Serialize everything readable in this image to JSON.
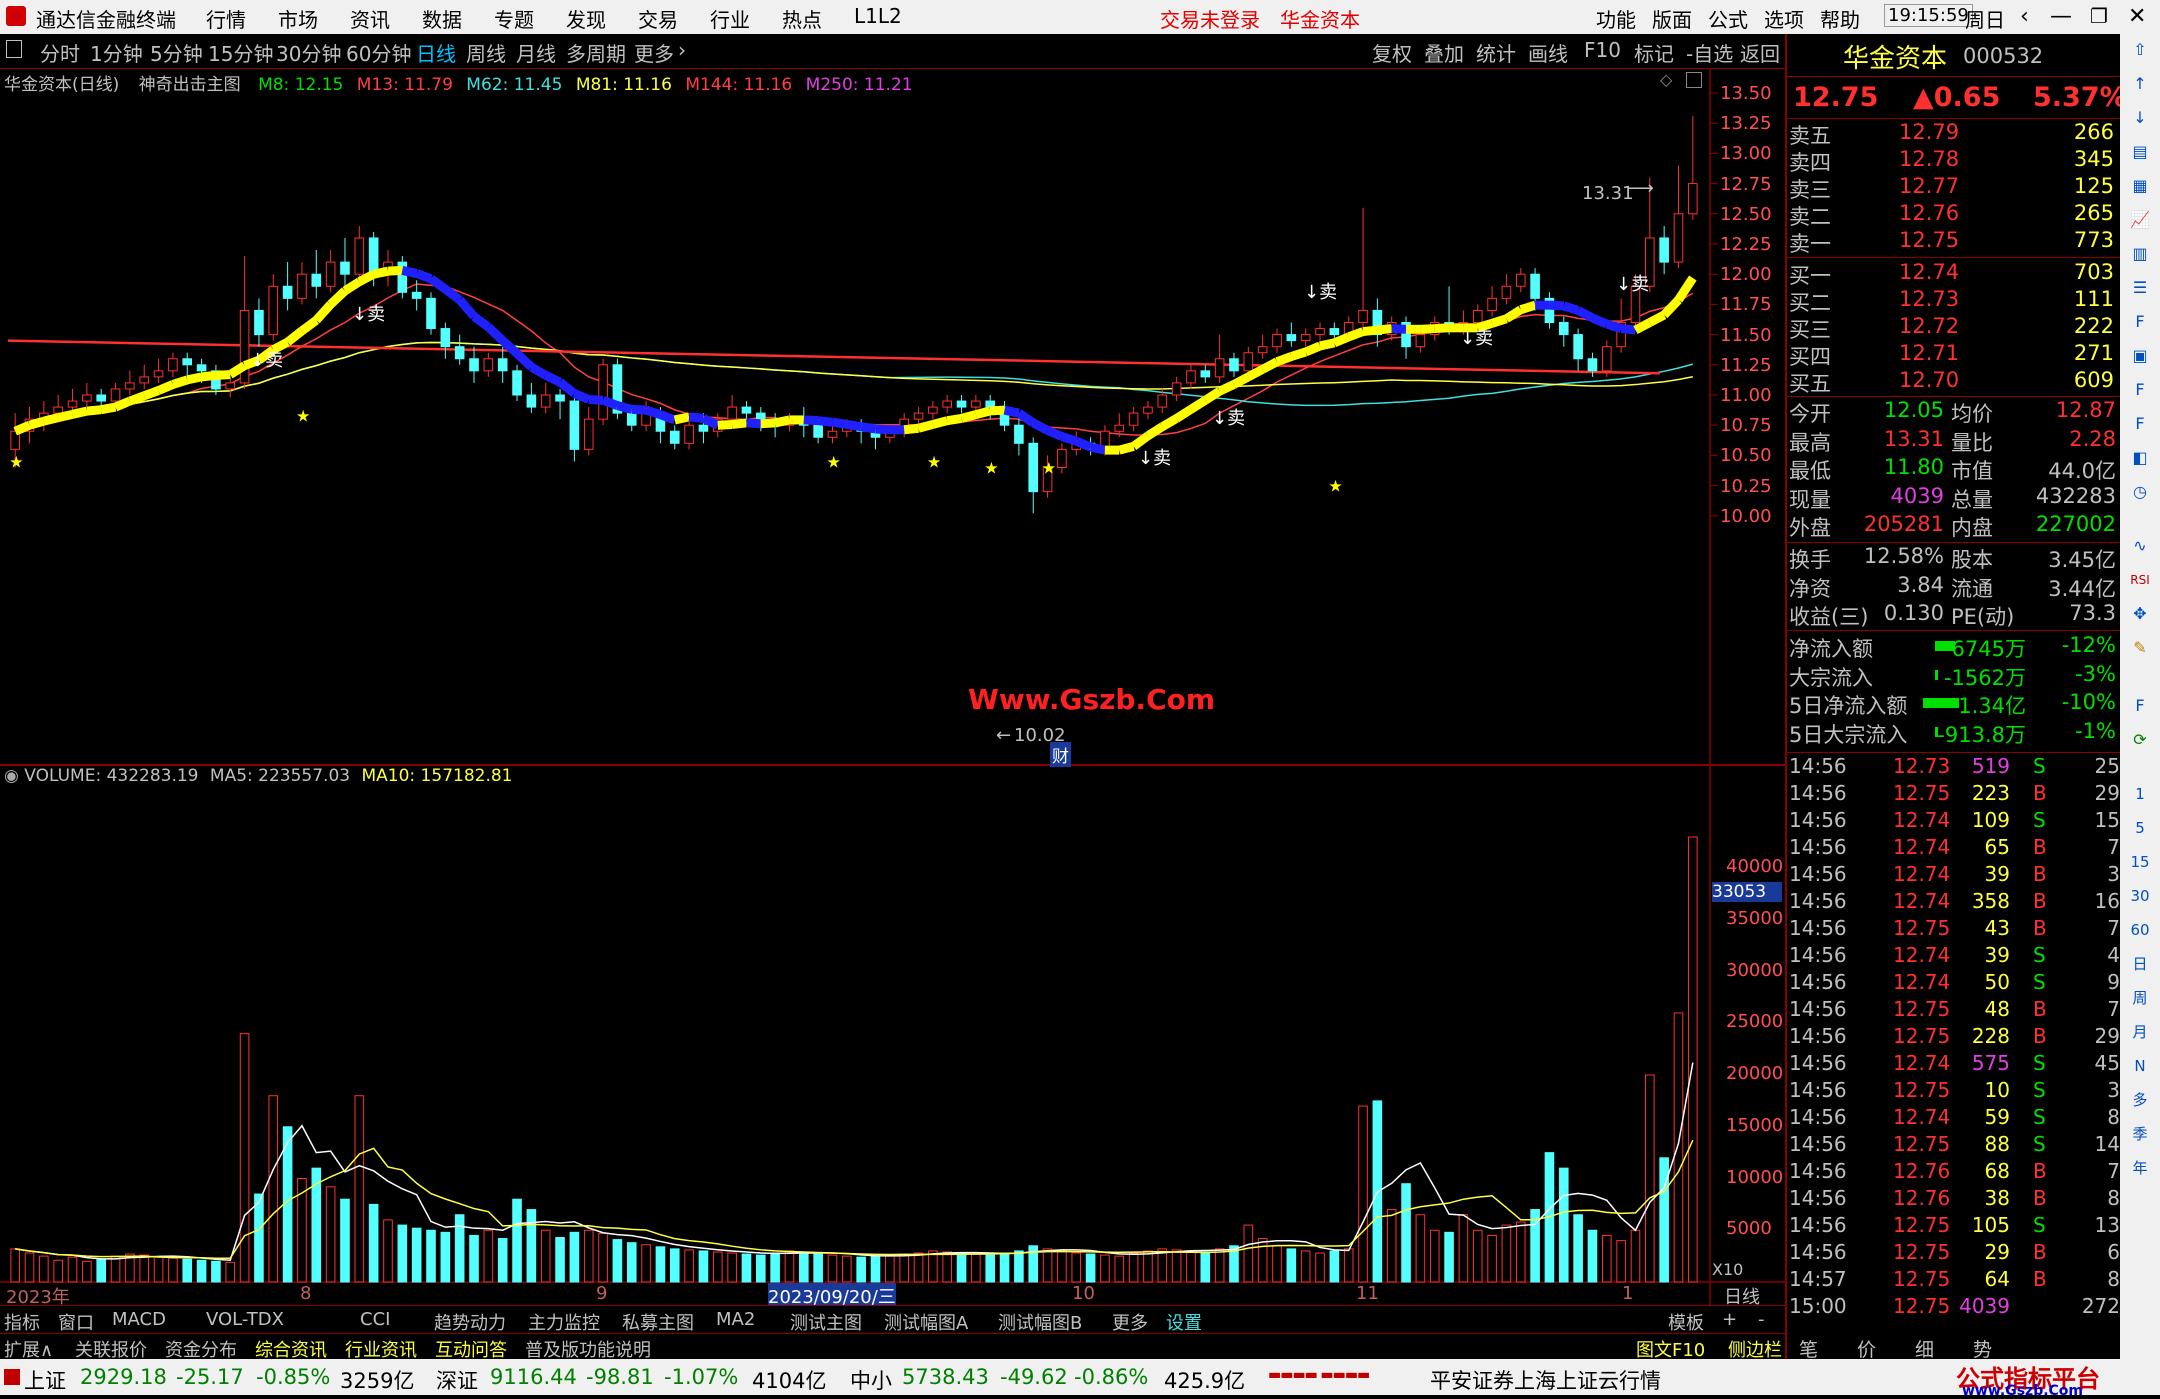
{
  "menubar": {
    "app_title": "通达信金融终端",
    "items": [
      "行情",
      "市场",
      "资讯",
      "数据",
      "专题",
      "发现",
      "交易",
      "行业",
      "热点",
      "L1L2"
    ],
    "login_status": "交易未登录",
    "stock_name": "华金资本",
    "right_items": [
      "功能",
      "版面",
      "公式",
      "选项",
      "帮助"
    ],
    "time": "19:15:59",
    "weekday": "周日"
  },
  "toolbar": {
    "periods": [
      "分时",
      "1分钟",
      "5分钟",
      "15分钟",
      "30分钟",
      "60分钟",
      "日线",
      "周线",
      "月线",
      "多周期",
      "更多"
    ],
    "active_period": "日线",
    "right_buttons": [
      "复权",
      "叠加",
      "统计",
      "画线",
      "F10",
      "标记",
      "-自选",
      "返回"
    ]
  },
  "main_chart": {
    "title": "华金资本(日线)",
    "indicator": "神奇出击主图",
    "ma": [
      {
        "label": "M8: 12.15",
        "color": "#00e000"
      },
      {
        "label": "M13: 11.79",
        "color": "#ff4040"
      },
      {
        "label": "M62: 11.45",
        "color": "#40e0e0"
      },
      {
        "label": "M81: 11.16",
        "color": "#ffff40"
      },
      {
        "label": "M144: 11.16",
        "color": "#ff4040"
      },
      {
        "label": "M250: 11.21",
        "color": "#e040e0"
      }
    ],
    "price_ticks": [
      "13.50",
      "13.25",
      "13.00",
      "12.75",
      "12.50",
      "12.25",
      "12.00",
      "11.75",
      "11.50",
      "11.25",
      "11.00",
      "10.75",
      "10.50",
      "10.25",
      "10.00"
    ],
    "high_label": "13.31",
    "low_label": "10.02",
    "sell_marks": [
      "↓卖",
      "↓卖",
      "↓卖",
      "↓卖",
      "↓卖",
      "↓卖",
      "↓卖"
    ],
    "watermark": "Www.Gszb.Com",
    "fin_badge": "财"
  },
  "volume_chart": {
    "label": "VOLUME: 432283.19",
    "ma5": "MA5: 223557.03",
    "ma10": "MA10: 157182.81",
    "ticks": [
      "40000",
      "35000",
      "30000",
      "25000",
      "20000",
      "15000",
      "10000",
      "5000"
    ],
    "cursor_value": "33053",
    "scale_note": "X10"
  },
  "date_axis": {
    "labels": [
      "2023年",
      "8",
      "9",
      "2023/09/20/三",
      "10",
      "11",
      "1"
    ],
    "period": "日线"
  },
  "indicator_tabs": [
    "指标",
    "窗口",
    "MACD",
    "VOL-TDX",
    "CCI",
    "趋势动力",
    "主力监控",
    "私募主图",
    "MA2",
    "测试主图",
    "测试幅图A",
    "测试幅图B",
    "更多",
    "设置"
  ],
  "indicator_right": [
    "模板",
    "+",
    "-"
  ],
  "ext_tabs": [
    "扩展∧",
    "关联报价",
    "资金分布",
    "综合资讯",
    "行业资讯",
    "互动问答",
    "普及版功能说明"
  ],
  "ext_right": [
    "图文F10",
    "侧边栏《",
    "笔",
    "价",
    "细",
    "势"
  ],
  "quote": {
    "name": "华金资本",
    "code": "000532",
    "price": "12.75",
    "change": "▲0.65",
    "pct": "5.37%",
    "asks": [
      {
        "label": "卖五",
        "price": "12.79",
        "vol": "266"
      },
      {
        "label": "卖四",
        "price": "12.78",
        "vol": "345"
      },
      {
        "label": "卖三",
        "price": "12.77",
        "vol": "125"
      },
      {
        "label": "卖二",
        "price": "12.76",
        "vol": "265"
      },
      {
        "label": "卖一",
        "price": "12.75",
        "vol": "773"
      }
    ],
    "bids": [
      {
        "label": "买一",
        "price": "12.74",
        "vol": "703"
      },
      {
        "label": "买二",
        "price": "12.73",
        "vol": "111"
      },
      {
        "label": "买三",
        "price": "12.72",
        "vol": "222"
      },
      {
        "label": "买四",
        "price": "12.71",
        "vol": "271"
      },
      {
        "label": "买五",
        "price": "12.70",
        "vol": "609"
      }
    ],
    "stats": [
      {
        "l1": "今开",
        "v1": "12.05",
        "l2": "均价",
        "v2": "12.87"
      },
      {
        "l1": "最高",
        "v1": "13.31",
        "l2": "量比",
        "v2": "2.28"
      },
      {
        "l1": "最低",
        "v1": "11.80",
        "l2": "市值",
        "v2": "44.0亿"
      },
      {
        "l1": "现量",
        "v1": "4039",
        "l2": "总量",
        "v2": "432283"
      },
      {
        "l1": "外盘",
        "v1": "205281",
        "l2": "内盘",
        "v2": "227002"
      }
    ],
    "stats2": [
      {
        "l1": "换手",
        "v1": "12.58%",
        "l2": "股本",
        "v2": "3.45亿"
      },
      {
        "l1": "净资",
        "v1": "3.84",
        "l2": "流通",
        "v2": "3.44亿"
      },
      {
        "l1": "收益(三)",
        "v1": "0.130",
        "l2": "PE(动)",
        "v2": "73.3"
      }
    ],
    "flows": [
      {
        "label": "净流入额",
        "value": "-6745万",
        "pct": "-12%"
      },
      {
        "label": "大宗流入",
        "value": "-1562万",
        "pct": "-3%"
      },
      {
        "label": "5日净流入额",
        "value": "-1.34亿",
        "pct": "-10%"
      },
      {
        "label": "5日大宗流入",
        "value": "-913.8万",
        "pct": "-1%"
      }
    ],
    "ticks": [
      {
        "t": "14:56",
        "p": "12.73",
        "v": "519",
        "s": "S",
        "n": "25"
      },
      {
        "t": "14:56",
        "p": "12.75",
        "v": "223",
        "s": "B",
        "n": "29"
      },
      {
        "t": "14:56",
        "p": "12.74",
        "v": "109",
        "s": "S",
        "n": "15"
      },
      {
        "t": "14:56",
        "p": "12.74",
        "v": "65",
        "s": "B",
        "n": "7"
      },
      {
        "t": "14:56",
        "p": "12.74",
        "v": "39",
        "s": "B",
        "n": "3"
      },
      {
        "t": "14:56",
        "p": "12.74",
        "v": "358",
        "s": "B",
        "n": "16"
      },
      {
        "t": "14:56",
        "p": "12.75",
        "v": "43",
        "s": "B",
        "n": "7"
      },
      {
        "t": "14:56",
        "p": "12.74",
        "v": "39",
        "s": "S",
        "n": "4"
      },
      {
        "t": "14:56",
        "p": "12.74",
        "v": "50",
        "s": "S",
        "n": "9"
      },
      {
        "t": "14:56",
        "p": "12.75",
        "v": "48",
        "s": "B",
        "n": "7"
      },
      {
        "t": "14:56",
        "p": "12.75",
        "v": "228",
        "s": "B",
        "n": "29"
      },
      {
        "t": "14:56",
        "p": "12.74",
        "v": "575",
        "s": "S",
        "n": "45"
      },
      {
        "t": "14:56",
        "p": "12.75",
        "v": "10",
        "s": "S",
        "n": "3"
      },
      {
        "t": "14:56",
        "p": "12.74",
        "v": "59",
        "s": "S",
        "n": "8"
      },
      {
        "t": "14:56",
        "p": "12.75",
        "v": "88",
        "s": "S",
        "n": "14"
      },
      {
        "t": "14:56",
        "p": "12.76",
        "v": "68",
        "s": "B",
        "n": "7"
      },
      {
        "t": "14:56",
        "p": "12.76",
        "v": "38",
        "s": "B",
        "n": "8"
      },
      {
        "t": "14:56",
        "p": "12.75",
        "v": "105",
        "s": "S",
        "n": "13"
      },
      {
        "t": "14:56",
        "p": "12.75",
        "v": "29",
        "s": "B",
        "n": "6"
      },
      {
        "t": "14:57",
        "p": "12.75",
        "v": "64",
        "s": "B",
        "n": "8"
      },
      {
        "t": "15:00",
        "p": "12.75",
        "v": "4039",
        "s": "",
        "n": "272"
      }
    ]
  },
  "side_icons": [
    "1",
    "5",
    "15",
    "30",
    "60",
    "日",
    "周",
    "月",
    "N",
    "多",
    "季",
    "年"
  ],
  "statusbar": {
    "sh_label": "上证",
    "sh_val": "2929.18",
    "sh_chg": "-25.17",
    "sh_pct": "-0.85%",
    "sh_amt": "3259亿",
    "sz_label": "深证",
    "sz_val": "9116.44",
    "sz_chg": "-98.81",
    "sz_pct": "-1.07%",
    "sz_amt": "4104亿",
    "zx_label": "中小",
    "zx_val": "5738.43",
    "zx_chg": "-49.62",
    "zx_pct": "-0.86%",
    "zx_amt": "425.9亿",
    "server": "平安证券上海上证云行情",
    "brand": "公式指标平台",
    "brand_url": "www.Gszb.Com"
  },
  "chart_data": {
    "type": "candlestick",
    "price_range": [
      10.0,
      13.5
    ],
    "volume_range": [
      0,
      43000
    ],
    "candles": [
      [
        10.55,
        10.7,
        10.4,
        10.85
      ],
      [
        10.7,
        10.8,
        10.6,
        10.9
      ],
      [
        10.8,
        10.85,
        10.7,
        10.95
      ],
      [
        10.85,
        10.9,
        10.8,
        11.0
      ],
      [
        10.9,
        10.95,
        10.85,
        11.05
      ],
      [
        10.95,
        11.0,
        10.9,
        11.1
      ],
      [
        11.0,
        10.95,
        10.85,
        11.05
      ],
      [
        10.95,
        11.05,
        10.9,
        11.1
      ],
      [
        11.05,
        11.1,
        11.0,
        11.2
      ],
      [
        11.1,
        11.15,
        11.05,
        11.25
      ],
      [
        11.15,
        11.2,
        11.1,
        11.3
      ],
      [
        11.2,
        11.3,
        11.15,
        11.35
      ],
      [
        11.3,
        11.25,
        11.15,
        11.35
      ],
      [
        11.25,
        11.2,
        11.1,
        11.3
      ],
      [
        11.2,
        11.05,
        11.0,
        11.25
      ],
      [
        11.05,
        11.1,
        10.98,
        11.15
      ],
      [
        11.1,
        11.7,
        11.05,
        12.15
      ],
      [
        11.7,
        11.5,
        11.4,
        11.8
      ],
      [
        11.5,
        11.9,
        11.45,
        12.0
      ],
      [
        11.9,
        11.8,
        11.7,
        12.1
      ],
      [
        11.8,
        12.0,
        11.75,
        12.1
      ],
      [
        12.0,
        11.9,
        11.8,
        12.2
      ],
      [
        11.9,
        12.1,
        11.85,
        12.2
      ],
      [
        12.1,
        12.0,
        11.9,
        12.3
      ],
      [
        12.0,
        12.3,
        11.95,
        12.4
      ],
      [
        12.3,
        12.0,
        11.9,
        12.35
      ],
      [
        12.0,
        12.1,
        11.9,
        12.2
      ],
      [
        12.1,
        11.85,
        11.8,
        12.15
      ],
      [
        11.85,
        11.8,
        11.7,
        11.95
      ],
      [
        11.8,
        11.55,
        11.5,
        11.85
      ],
      [
        11.55,
        11.4,
        11.3,
        11.6
      ],
      [
        11.4,
        11.3,
        11.25,
        11.5
      ],
      [
        11.3,
        11.2,
        11.1,
        11.4
      ],
      [
        11.2,
        11.3,
        11.15,
        11.35
      ],
      [
        11.3,
        11.2,
        11.1,
        11.4
      ],
      [
        11.2,
        11.0,
        10.95,
        11.25
      ],
      [
        11.0,
        10.9,
        10.85,
        11.1
      ],
      [
        10.9,
        11.0,
        10.85,
        11.1
      ],
      [
        11.0,
        10.95,
        10.8,
        11.05
      ],
      [
        10.95,
        10.55,
        10.45,
        11.0
      ],
      [
        10.55,
        10.8,
        10.5,
        10.9
      ],
      [
        10.8,
        11.25,
        10.75,
        11.3
      ],
      [
        11.25,
        10.85,
        10.8,
        11.3
      ],
      [
        10.85,
        10.75,
        10.7,
        10.9
      ],
      [
        10.75,
        10.85,
        10.7,
        10.95
      ],
      [
        10.85,
        10.7,
        10.6,
        10.9
      ],
      [
        10.7,
        10.6,
        10.55,
        10.75
      ],
      [
        10.6,
        10.75,
        10.55,
        10.8
      ],
      [
        10.75,
        10.7,
        10.6,
        10.85
      ],
      [
        10.7,
        10.8,
        10.65,
        10.85
      ],
      [
        10.8,
        10.9,
        10.75,
        11.0
      ],
      [
        10.9,
        10.85,
        10.8,
        10.95
      ],
      [
        10.85,
        10.8,
        10.7,
        10.9
      ],
      [
        10.8,
        10.75,
        10.65,
        10.85
      ],
      [
        10.75,
        10.8,
        10.7,
        10.85
      ],
      [
        10.8,
        10.75,
        10.65,
        10.9
      ],
      [
        10.75,
        10.65,
        10.6,
        10.8
      ],
      [
        10.65,
        10.7,
        10.6,
        10.75
      ],
      [
        10.7,
        10.75,
        10.65,
        10.8
      ],
      [
        10.75,
        10.7,
        10.6,
        10.8
      ],
      [
        10.7,
        10.65,
        10.55,
        10.75
      ],
      [
        10.65,
        10.7,
        10.6,
        10.75
      ],
      [
        10.7,
        10.8,
        10.65,
        10.85
      ],
      [
        10.8,
        10.85,
        10.75,
        10.9
      ],
      [
        10.85,
        10.9,
        10.8,
        10.95
      ],
      [
        10.9,
        10.95,
        10.85,
        11.0
      ],
      [
        10.95,
        10.9,
        10.85,
        11.0
      ],
      [
        10.9,
        10.95,
        10.85,
        11.0
      ],
      [
        10.95,
        10.9,
        10.8,
        11.0
      ],
      [
        10.9,
        10.75,
        10.7,
        10.95
      ],
      [
        10.75,
        10.6,
        10.5,
        10.8
      ],
      [
        10.6,
        10.2,
        10.02,
        10.65
      ],
      [
        10.2,
        10.4,
        10.15,
        10.5
      ],
      [
        10.4,
        10.55,
        10.35,
        10.6
      ],
      [
        10.55,
        10.6,
        10.5,
        10.7
      ],
      [
        10.6,
        10.55,
        10.5,
        10.65
      ],
      [
        10.55,
        10.7,
        10.5,
        10.75
      ],
      [
        10.7,
        10.75,
        10.65,
        10.85
      ],
      [
        10.75,
        10.85,
        10.7,
        10.9
      ],
      [
        10.85,
        10.9,
        10.8,
        10.95
      ],
      [
        10.9,
        11.0,
        10.85,
        11.05
      ],
      [
        11.0,
        11.1,
        10.95,
        11.15
      ],
      [
        11.1,
        11.2,
        11.05,
        11.25
      ],
      [
        11.2,
        11.15,
        11.1,
        11.25
      ],
      [
        11.15,
        11.3,
        11.1,
        11.5
      ],
      [
        11.3,
        11.2,
        11.15,
        11.35
      ],
      [
        11.2,
        11.35,
        11.15,
        11.4
      ],
      [
        11.35,
        11.4,
        11.3,
        11.5
      ],
      [
        11.4,
        11.5,
        11.35,
        11.55
      ],
      [
        11.5,
        11.45,
        11.4,
        11.6
      ],
      [
        11.45,
        11.5,
        11.4,
        11.55
      ],
      [
        11.5,
        11.55,
        11.45,
        11.6
      ],
      [
        11.55,
        11.5,
        11.45,
        11.6
      ],
      [
        11.5,
        11.6,
        11.45,
        11.65
      ],
      [
        11.6,
        11.7,
        11.5,
        12.55
      ],
      [
        11.7,
        11.5,
        11.4,
        11.8
      ],
      [
        11.5,
        11.6,
        11.45,
        11.65
      ],
      [
        11.6,
        11.4,
        11.3,
        11.65
      ],
      [
        11.4,
        11.5,
        11.35,
        11.55
      ],
      [
        11.5,
        11.6,
        11.45,
        11.65
      ],
      [
        11.6,
        11.55,
        11.5,
        11.9
      ],
      [
        11.55,
        11.6,
        11.5,
        11.7
      ],
      [
        11.6,
        11.7,
        11.55,
        11.75
      ],
      [
        11.7,
        11.8,
        11.65,
        11.9
      ],
      [
        11.8,
        11.9,
        11.75,
        12.0
      ],
      [
        11.9,
        12.0,
        11.85,
        12.05
      ],
      [
        12.0,
        11.8,
        11.7,
        12.05
      ],
      [
        11.8,
        11.6,
        11.55,
        11.85
      ],
      [
        11.6,
        11.5,
        11.4,
        11.65
      ],
      [
        11.5,
        11.3,
        11.2,
        11.55
      ],
      [
        11.3,
        11.2,
        11.15,
        11.35
      ],
      [
        11.2,
        11.4,
        11.15,
        11.45
      ],
      [
        11.4,
        11.6,
        11.35,
        11.8
      ],
      [
        11.6,
        11.9,
        11.55,
        12.0
      ],
      [
        11.9,
        12.3,
        11.85,
        12.8
      ],
      [
        12.3,
        12.1,
        12.0,
        12.4
      ],
      [
        12.1,
        12.5,
        12.05,
        12.9
      ],
      [
        12.5,
        12.75,
        12.45,
        13.31
      ]
    ],
    "volumes": [
      3200,
      2800,
      2500,
      2100,
      2400,
      2000,
      2200,
      2500,
      2700,
      2600,
      2400,
      2300,
      2200,
      2100,
      2000,
      1900,
      24000,
      8500,
      18000,
      15000,
      10000,
      11000,
      9200,
      8000,
      18000,
      7500,
      6000,
      5500,
      5200,
      5000,
      4800,
      6500,
      4500,
      5000,
      4200,
      8000,
      7000,
      5000,
      4300,
      4800,
      5000,
      4700,
      4100,
      3800,
      3600,
      3400,
      3200,
      3100,
      3000,
      2900,
      2800,
      2700,
      2600,
      2800,
      3000,
      2900,
      2700,
      2600,
      2500,
      2400,
      2500,
      2600,
      2700,
      2800,
      3000,
      2900,
      2800,
      2700,
      2600,
      2800,
      3000,
      3500,
      3200,
      3000,
      2800,
      2700,
      2600,
      2500,
      2800,
      3000,
      3200,
      3100,
      3000,
      2900,
      3200,
      3500,
      5500,
      4200,
      3500,
      3200,
      3000,
      2800,
      3000,
      3200,
      17000,
      17500,
      7000,
      9500,
      6500,
      5000,
      4800,
      6500,
      5000,
      4500,
      5500,
      5800,
      7000,
      12500,
      11000,
      6500,
      5000,
      4500,
      4000,
      5000,
      20000,
      12000,
      26000,
      43000
    ]
  }
}
